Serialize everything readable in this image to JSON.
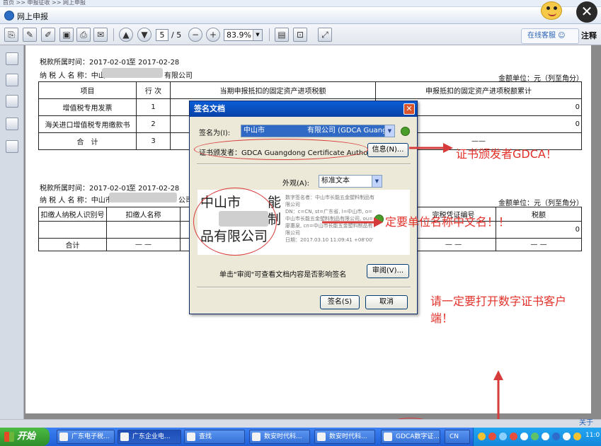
{
  "window": {
    "breadcrumb": "首页 >> 申报征收 >> 网上申报",
    "title": "网上申报"
  },
  "toolbar": {
    "page_current": "5",
    "page_total": "/ 5",
    "zoom": "83.9%",
    "online_service": "在线客服",
    "annotation": "注释"
  },
  "document": {
    "section1": {
      "period_label": "税款所属时间：2017-02-01",
      "period_to": "至  2017-02-28",
      "taxpayer_label": "纳 税 人 名 称：中山",
      "taxpayer_suffix": "有限公司",
      "unit": "金额单位：元（列至角分）",
      "headers": [
        "项目",
        "行 次",
        "当期申报抵扣的固定资产进项税额",
        "申报抵扣的固定资产进项税额累计"
      ],
      "rows": [
        {
          "item": "增值税专用发票",
          "line": "1",
          "current": "",
          "total": "0"
        },
        {
          "item": "海关进口增值税专用缴款书",
          "line": "2",
          "current": "",
          "total": "0"
        },
        {
          "item": "合　计",
          "line": "3",
          "current": "",
          "total": "——"
        }
      ]
    },
    "section2": {
      "period_label": "税款所属时间：2017-02-01",
      "period_to": "至  2017-02-28",
      "taxpayer_label": "纳 税 人 名 称：中山市",
      "taxpayer_suffix": "公司",
      "unit": "金额单位：元（列至角分）",
      "headers": [
        "扣缴人纳税人识别号",
        "扣缴人名称",
        "完税凭证编号",
        "税额"
      ],
      "row_value": "0",
      "total_label": "合计",
      "dash": "— —"
    }
  },
  "dialog": {
    "title": "签名文档",
    "sign_as_label": "签名为(I):",
    "sign_as_value": "中山市　　　　　　有限公司 (GDCA Guangdo",
    "issuer_text": "证书颁发者：GDCA Guangdong Certificate Authority",
    "info_button": "信息(N)...",
    "appearance_label": "外观(A):",
    "appearance_value": "标准文本",
    "preview_name": "中山市　　能\n　　命　　制\n品有限公司",
    "preview_details": "数字签名者：中山市长能五金塑料制品有限公司\nDN：c=CN, st=广东省, l=中山市, o=中山市长能五金塑料制品有限公司, ou=廖惠泉, cn=中山市长能五金塑料制品有限公司\n日期：2017.03.10 11:09:41 +08'00'",
    "review_text": "单击\"审阅\"可查看文档内容是否影响签名",
    "review_button": "审阅(V)...",
    "sign_button": "签名(S)",
    "cancel_button": "取消"
  },
  "annotations": {
    "issuer_note": "证书颁发者GDCA！",
    "chinese_name_note": "定要单位名称中文名！！",
    "client_note_line1": "请一定要打开数字证书客户",
    "client_note_line2": "端！",
    "color": "#e3312b"
  },
  "statusbar": {
    "about": "关于"
  },
  "taskbar": {
    "start": "开始",
    "tasks": [
      "广东电子税...",
      "广东企业电...",
      "查找",
      "数安时代科...",
      "数安时代科...",
      "GDCA数字证...",
      "CN"
    ],
    "clock": "11:0"
  }
}
